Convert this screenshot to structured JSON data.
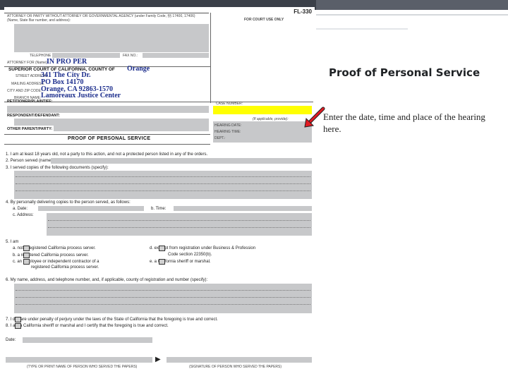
{
  "slide": {
    "title": "Proof of Personal Service",
    "note": "Enter the date, time and place of the hearing here."
  },
  "form": {
    "code": "FL-330",
    "attorney_header": "ATTORNEY OR PARTY WITHOUT ATTORNEY OR GOVERNMENTAL AGENCY (under Family Code, §§ 17400, 17406)",
    "attorney_sub": "(Name, State Bar number, and address):",
    "court_use_only": "FOR COURT USE ONLY",
    "telephone_label": "TELEPHONE NO.:",
    "fax_label": "FAX NO.:",
    "attorney_for_label": "ATTORNEY FOR (Name):",
    "attorney_for_value": "IN PRO PER",
    "superior_court": "SUPERIOR COURT OF CALIFORNIA, COUNTY OF",
    "county": "Orange",
    "street_label": "STREET ADDRESS:",
    "street_value": "341 The City Dr.",
    "mailing_label": "MAILING ADDRESS:",
    "mailing_value": "PO Box 14170",
    "city_label": "CITY AND ZIP CODE:",
    "city_value": "Orange, CA 92863-1570",
    "branch_label": "BRANCH NAME:",
    "branch_value": "Lamoreaux Justice Center",
    "petitioner_label": "PETITIONER/PLAINTIFF:",
    "respondent_label": "RESPONDENT/DEFENDANT:",
    "other_parent_label": "OTHER PARENT/PARTY:",
    "case_number_label": "CASE NUMBER:",
    "if_applicable": "(If applicable, provide):",
    "hearing_date_label": "HEARING DATE:",
    "hearing_time_label": "HEARING TIME:",
    "dept_label": "DEPT.:",
    "form_title": "PROOF OF PERSONAL SERVICE",
    "item1": "1.   I am at least 18 years old, not a party to this action, and not a protected person listed in any of the orders.",
    "item2": "2.   Person served (name):",
    "item3": "3.   I served copies of the following documents (specify):",
    "item4": "4.   By personally delivering copies to the person served, as follows:",
    "item4a": "a.   Date:",
    "item4b": "b.   Time:",
    "item4c": "c.   Address:",
    "item5": "5.   I am",
    "item5a": "a.        not a registered California process server.",
    "item5b": "b.        a registered California process server.",
    "item5c": "c.        an employee or independent contractor of a",
    "item5c2": "registered California process server.",
    "item5d": "d.        exempt from registration under Business & Profession",
    "item5d2": "Code section 22350(b).",
    "item5e": "e.        a California sheriff or marshal.",
    "item6": "6.   My name, address, and telephone number, and, if applicable, county of registration and number (specify):",
    "item7": "7.        I declare under penalty of perjury under the laws of the State of California that the foregoing is true and correct.",
    "item8": "8.        I am a California sheriff or marshal and I certify that the foregoing is true and correct.",
    "date_label": "Date:",
    "sig_left": "(TYPE OR PRINT NAME OF PERSON WHO SERVED THE PAPERS)",
    "sig_right": "(SIGNATURE OF PERSON WHO SERVED THE PAPERS)"
  },
  "colors": {
    "handwriting": "#1b2d8c",
    "highlight": "#ffff00",
    "arrow": "#e31b23",
    "field_fill": "#c7c8ca"
  }
}
